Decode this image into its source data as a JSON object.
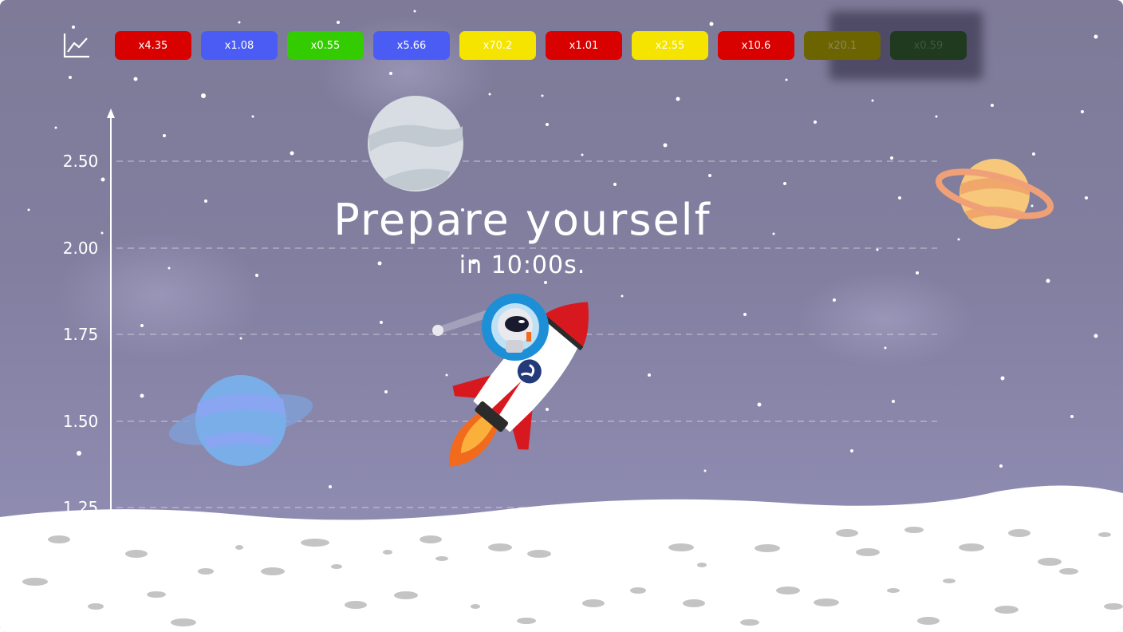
{
  "game": {
    "title": "Prepare yourself",
    "countdown_prefix": "in",
    "countdown_value": "10:00s."
  },
  "history": {
    "icon": "chart-line-icon",
    "items": [
      {
        "label": "x4.35",
        "color": "#d90000",
        "text_color": "#ffffff"
      },
      {
        "label": "x1.08",
        "color": "#4b5cf5",
        "text_color": "#ffffff"
      },
      {
        "label": "x0.55",
        "color": "#33cc00",
        "text_color": "#ffffff"
      },
      {
        "label": "x5.66",
        "color": "#4b5cf5",
        "text_color": "#ffffff"
      },
      {
        "label": "x70.2",
        "color": "#f5e400",
        "text_color": "#ffffff"
      },
      {
        "label": "x1.01",
        "color": "#d90000",
        "text_color": "#ffffff"
      },
      {
        "label": "x2.55",
        "color": "#f5e400",
        "text_color": "#ffffff"
      },
      {
        "label": "x10.6",
        "color": "#d90000",
        "text_color": "#ffffff"
      },
      {
        "label": "x20.1",
        "color": "#6b6400",
        "text_color": "#8c8660"
      },
      {
        "label": "x0.59",
        "color": "#1f3a1f",
        "text_color": "#3d5a3d"
      }
    ]
  },
  "axis": {
    "ticks": [
      "2.50",
      "2.00",
      "1.75",
      "1.50",
      "1.25"
    ]
  },
  "colors": {
    "sky": "#817e9f",
    "ground": "#ffffff",
    "crater": "#c4c4c4"
  }
}
